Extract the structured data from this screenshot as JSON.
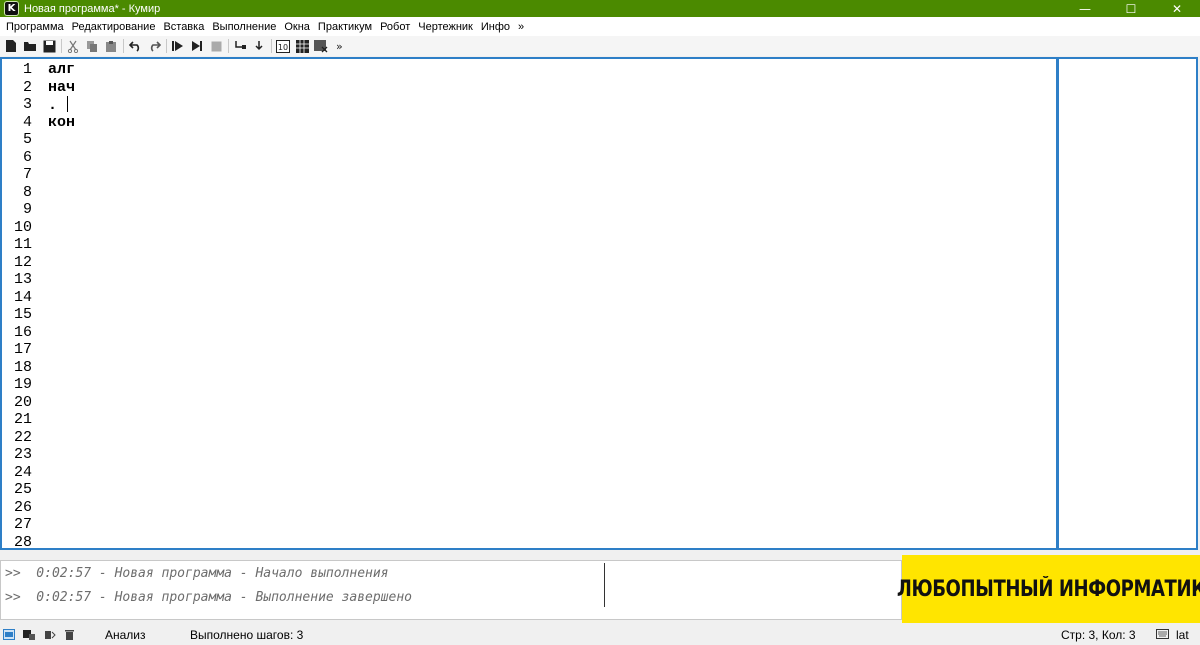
{
  "window": {
    "app_icon_letter": "K",
    "title": "Новая программа* - Кумир",
    "controls": {
      "minimize": "—",
      "maximize": "☐",
      "close": "✕"
    }
  },
  "menu": [
    "Программа",
    "Редактирование",
    "Вставка",
    "Выполнение",
    "Окна",
    "Практикум",
    "Робот",
    "Чертежник",
    "Инфо",
    "»"
  ],
  "toolbar": {
    "buttons": [
      "new-file-icon",
      "open-folder-icon",
      "save-icon",
      "cut-icon",
      "copy-icon",
      "paste-icon",
      "undo-icon",
      "redo-icon",
      "run-icon",
      "run-step-icon",
      "stop-icon",
      "step-into-icon",
      "step-out-icon",
      "ten-icon",
      "grid-icon",
      "table-icon"
    ],
    "more": "»"
  },
  "editor": {
    "line_numbers": [
      "1",
      "2",
      "3",
      "4",
      "5",
      "6",
      "7",
      "8",
      "9",
      "10",
      "11",
      "12",
      "13",
      "14",
      "15",
      "16",
      "17",
      "18",
      "19",
      "20",
      "21",
      "22",
      "23",
      "24",
      "25",
      "26",
      "27",
      "28"
    ],
    "lines": [
      "алг",
      "нач",
      ". ",
      "кон"
    ]
  },
  "console": {
    "lines": [
      ">>  0:02:57 - Новая программа - Начало выполнения",
      ">>  0:02:57 - Новая программа - Выполнение завершено"
    ]
  },
  "banner": {
    "text": "ЛЮБОПЫТНЫЙ ИНФОРМАТИК",
    "color": "#ffe500"
  },
  "status": {
    "mode": "Анализ",
    "steps": "Выполнено шагов: 3",
    "position": "Стр: 3, Кол: 3",
    "layout": "lat"
  },
  "colors": {
    "titlebar": "#4b8a00",
    "editor_border": "#2e7fc7"
  }
}
